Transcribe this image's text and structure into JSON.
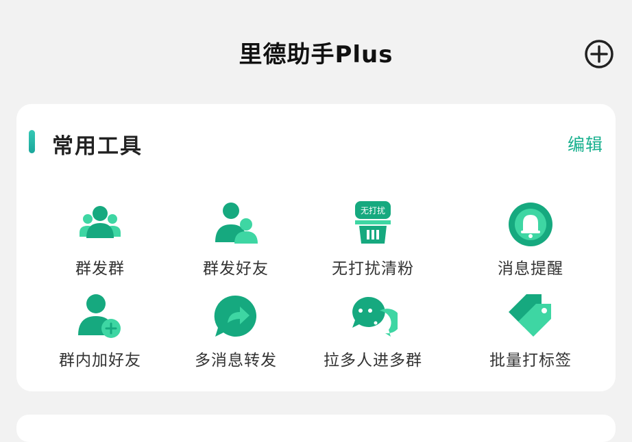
{
  "header": {
    "title": "里德助手Plus"
  },
  "section": {
    "title": "常用工具",
    "edit_label": "编辑"
  },
  "tools": [
    {
      "label": "群发群",
      "icon": "group-send-group-icon"
    },
    {
      "label": "群发好友",
      "icon": "group-send-friends-icon"
    },
    {
      "label": "无打扰清粉",
      "icon": "no-disturb-clear-fans-icon",
      "badge": "无打扰"
    },
    {
      "label": "消息提醒",
      "icon": "bell-reminder-icon"
    },
    {
      "label": "群内加好友",
      "icon": "add-friend-in-group-icon"
    },
    {
      "label": "多消息转发",
      "icon": "forward-message-icon"
    },
    {
      "label": "拉多人进多群",
      "icon": "pull-people-into-groups-icon"
    },
    {
      "label": "批量打标签",
      "icon": "batch-tag-icon"
    }
  ],
  "colors": {
    "accent": "#18b08e",
    "icon_dark": "#16a97f",
    "icon_light": "#3ed6a3",
    "background": "#f2f2f2"
  }
}
